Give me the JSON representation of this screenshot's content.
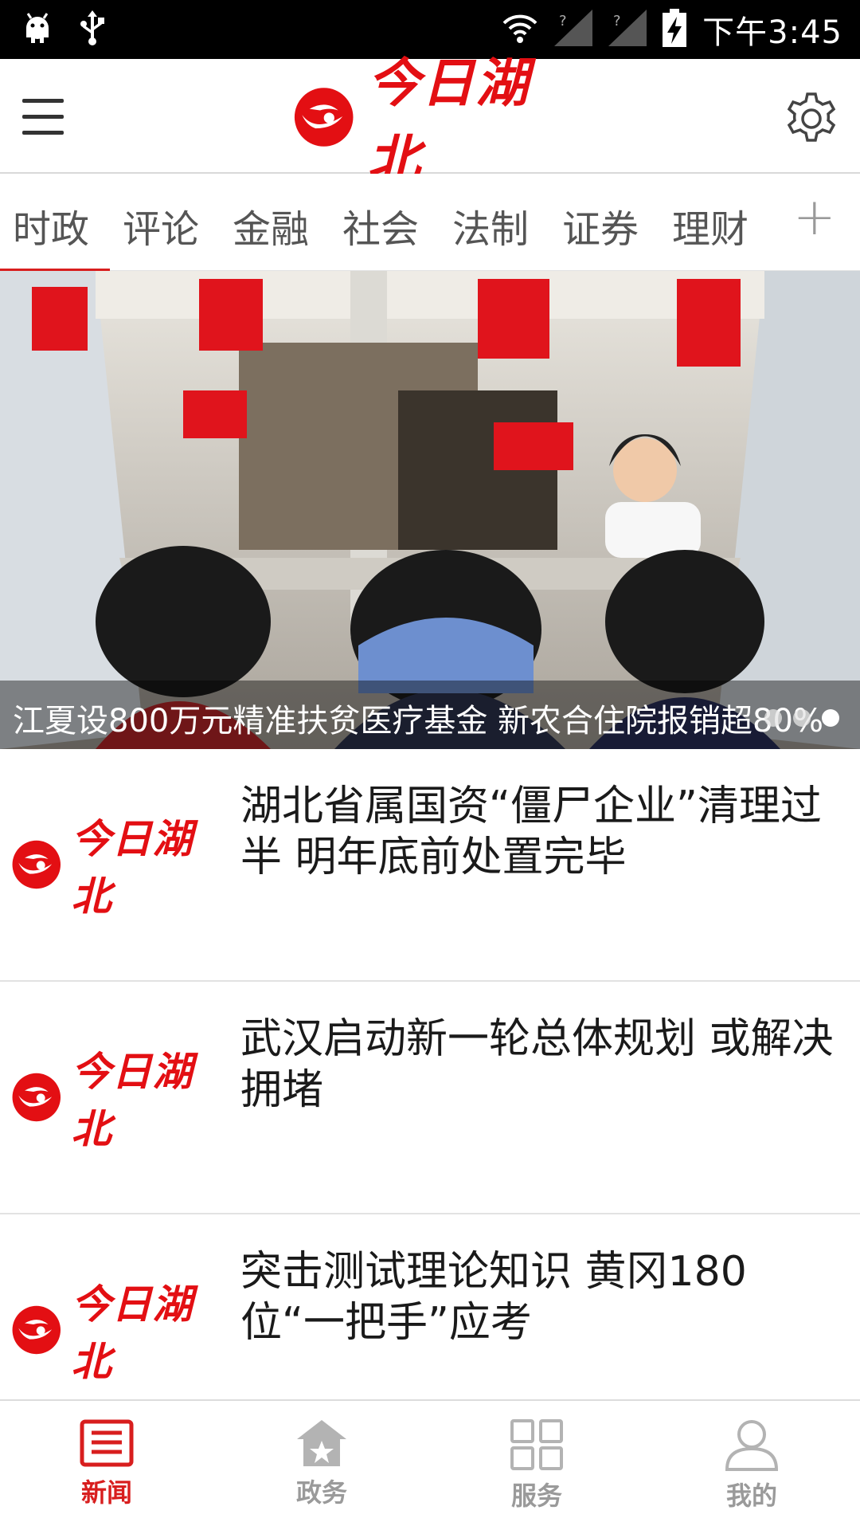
{
  "status_bar": {
    "time": "下午3:45",
    "icons": [
      "android-icon",
      "usb-icon",
      "wifi-icon",
      "signal-icon",
      "signal-icon",
      "battery-charging-icon"
    ]
  },
  "header": {
    "logo_text": "今日湖北",
    "menu_icon": "menu-icon",
    "settings_icon": "gear-icon"
  },
  "tabs": {
    "items": [
      "时政",
      "评论",
      "金融",
      "社会",
      "法制",
      "证券",
      "理财"
    ],
    "active_index": 0,
    "more_label": "+"
  },
  "hero": {
    "caption": "江夏设800万元精准扶贫医疗基金 新农合住院报销超80%",
    "slides": 3,
    "active_slide": 3
  },
  "news": [
    {
      "thumb_logo": "今日湖北",
      "title": "湖北省属国资“僵尸企业”清理过半 明年底前处置完毕"
    },
    {
      "thumb_logo": "今日湖北",
      "title": " 武汉启动新一轮总体规划 或解决拥堵"
    },
    {
      "thumb_logo": "今日湖北",
      "title": "突击测试理论知识 黄冈180位“一把手”应考"
    }
  ],
  "bottom_nav": {
    "items": [
      {
        "label": "新闻",
        "icon": "newspaper-icon",
        "active": true
      },
      {
        "label": "政务",
        "icon": "government-icon",
        "active": false
      },
      {
        "label": "服务",
        "icon": "grid-icon",
        "active": false
      },
      {
        "label": "我的",
        "icon": "user-icon",
        "active": false
      }
    ]
  },
  "colors": {
    "brand_red": "#e30f13",
    "active_nav": "#d81e1e",
    "inactive_nav": "#9a9a9a"
  }
}
